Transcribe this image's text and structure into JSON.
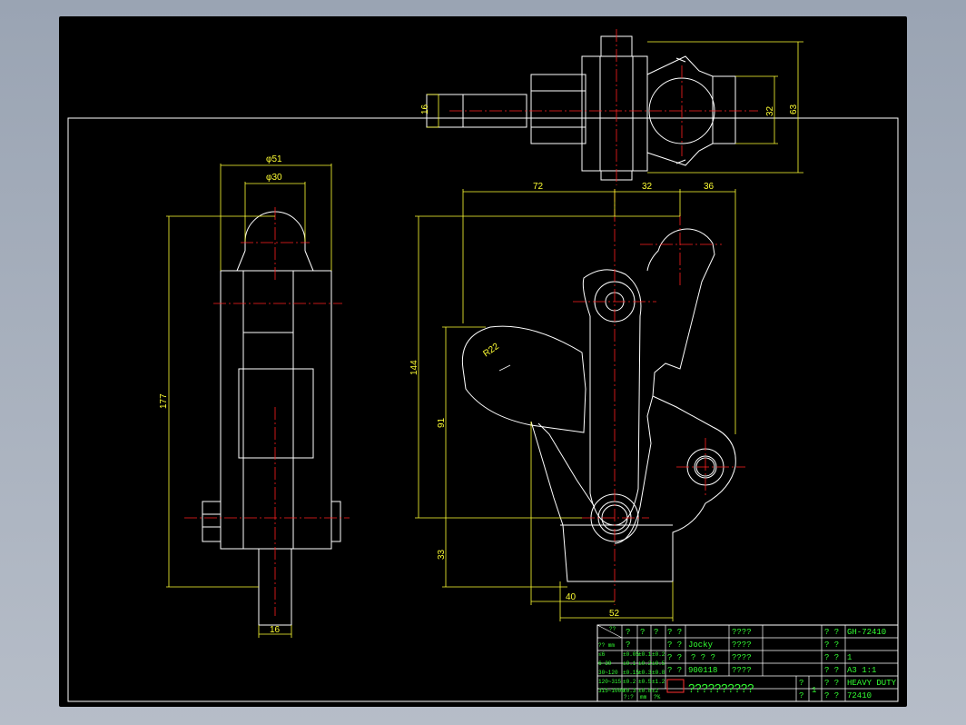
{
  "dimensions": {
    "d_phi51": "φ51",
    "d_phi30": "φ30",
    "d_177": "177",
    "d_16_left": "16",
    "d_16_top": "16",
    "d_32_top": "32",
    "d_63": "63",
    "d_72": "72",
    "d_32_front": "32",
    "d_36": "36",
    "d_144": "144",
    "d_91": "91",
    "d_33": "33",
    "d_40": "40",
    "d_52": "52",
    "d_r22": "R22"
  },
  "title_block": {
    "corner_top": "?? ",
    "corner_mid": "?? mm",
    "tol_rows": [
      [
        "≤6",
        "±0.05",
        "±0.1",
        "±0.2"
      ],
      [
        "6~30",
        "±0.1",
        "±0.2",
        "±0.5"
      ],
      [
        "30~120",
        "±0.15",
        "±0.3",
        "±0.8"
      ],
      [
        "120~315",
        "±0.2",
        "±0.5",
        "±1.2"
      ],
      [
        "315~1000",
        "±0.3",
        "±0.8",
        "±2"
      ]
    ],
    "q1": "?",
    "q2": "?",
    "q3": "?",
    "q4": "?",
    "row_labels": [
      "? ?",
      "? ?",
      "? ?",
      "? ?"
    ],
    "designer": "Jocky",
    "date_code": "900118",
    "checker": "? ? ?",
    "col_labels": [
      "????",
      "????",
      "????",
      "????"
    ],
    "company": "??????????",
    "part_code": "GH-72410",
    "qty": "1",
    "sheet": "A3  1:1",
    "name": "HEAVY DUTY",
    "number": "72410",
    "sheet_q1": "?",
    "sheet_q2": "?",
    "sheet_n": "1",
    "mat_q": "?  ?",
    "mm": "mm",
    "ratio_q": "?:?",
    "pct_q": "?%"
  }
}
